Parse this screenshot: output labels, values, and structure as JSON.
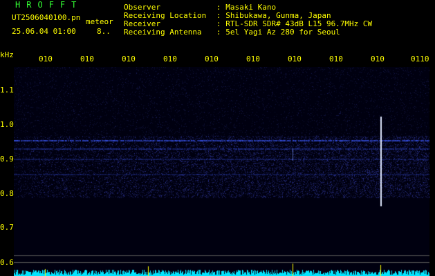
{
  "header": {
    "logo": "HROFFT",
    "file_name": "UT2506040100.pn",
    "mode": "meteor",
    "timestamp": "25.06.04 01:00",
    "count": "8..",
    "fields": [
      {
        "label": "Observer",
        "value": ": Masaki Kano"
      },
      {
        "label": "Receiving Location",
        "value": ": Shibukawa, Gunma, Japan"
      },
      {
        "label": "Receiver",
        "value": ": RTL-SDR SDR# 43dB L15 96.7MHz CW"
      },
      {
        "label": "Receiving Antenna",
        "value": ": 5el Yagi Az 280 for Seoul"
      }
    ]
  },
  "axis": {
    "unit": "kHz",
    "time_ticks": [
      "010",
      "010",
      "010",
      "010",
      "010",
      "010",
      "010",
      "010",
      "010",
      "0110"
    ],
    "freq_ticks": [
      "1.1",
      "1.0",
      "0.9",
      "0.8",
      "0.7",
      "0.6"
    ]
  },
  "colors": {
    "text": "#ffff00",
    "logo": "#33ff33",
    "signal": "#3355ff",
    "meteor": "#ffffff",
    "level": "#00e5ff"
  }
}
